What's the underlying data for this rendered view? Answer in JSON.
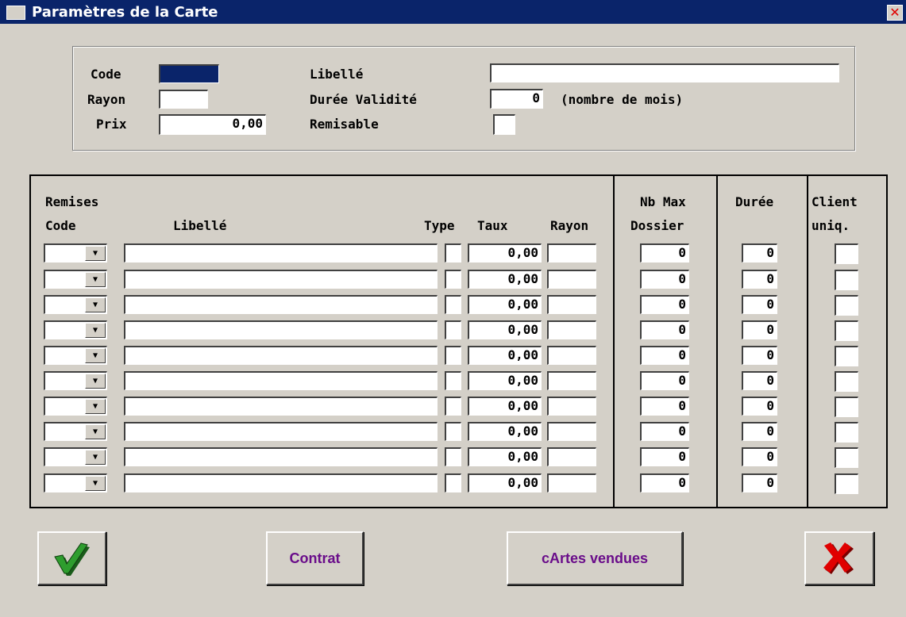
{
  "window": {
    "title": "Paramètres de la Carte"
  },
  "header": {
    "code_label": "Code",
    "rayon_label": "Rayon",
    "prix_label": "Prix",
    "prix_value": "0,00",
    "libelle_label": "Libellé",
    "duree_label": "Durée Validité",
    "duree_value": "0",
    "duree_unit": "(nombre de mois)",
    "remisable_label": "Remisable"
  },
  "table": {
    "group_label": "Remises",
    "columns": {
      "code": "Code",
      "libelle": "Libellé",
      "type": "Type",
      "taux": "Taux",
      "rayon": "Rayon",
      "nbmax1": "Nb Max",
      "nbmax2": "Dossier",
      "duree": "Durée",
      "client1": "Client",
      "client2": "uniq."
    },
    "rows": [
      {
        "taux": "0,00",
        "nbmax": "0",
        "duree": "0"
      },
      {
        "taux": "0,00",
        "nbmax": "0",
        "duree": "0"
      },
      {
        "taux": "0,00",
        "nbmax": "0",
        "duree": "0"
      },
      {
        "taux": "0,00",
        "nbmax": "0",
        "duree": "0"
      },
      {
        "taux": "0,00",
        "nbmax": "0",
        "duree": "0"
      },
      {
        "taux": "0,00",
        "nbmax": "0",
        "duree": "0"
      },
      {
        "taux": "0,00",
        "nbmax": "0",
        "duree": "0"
      },
      {
        "taux": "0,00",
        "nbmax": "0",
        "duree": "0"
      },
      {
        "taux": "0,00",
        "nbmax": "0",
        "duree": "0"
      },
      {
        "taux": "0,00",
        "nbmax": "0",
        "duree": "0"
      }
    ]
  },
  "buttons": {
    "ok_icon": "checkmark-icon",
    "contrat": "Contrat",
    "cartes": "cArtes vendues",
    "cancel_icon": "cross-icon"
  },
  "colors": {
    "title_bar": "#0a246a",
    "button_text": "#6a0d8a",
    "check_green": "#2e9d2e",
    "cross_red": "#e00000"
  }
}
